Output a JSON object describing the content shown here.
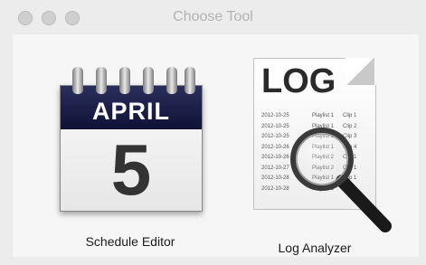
{
  "window": {
    "title": "Choose Tool"
  },
  "tools": {
    "schedule": {
      "label": "Schedule Editor",
      "icon": "calendar-icon",
      "month": "APRIL",
      "day": "5"
    },
    "log": {
      "label": "Log Analyzer",
      "icon": "log-document-icon",
      "doc_title": "LOG",
      "rows": [
        {
          "date": "2012-10-25",
          "playlist": "Playlist 1",
          "clip": "Clip 1"
        },
        {
          "date": "2012-10-25",
          "playlist": "Playlist 1",
          "clip": "Clip 2"
        },
        {
          "date": "2012-10-25",
          "playlist": "Playlist 1",
          "clip": "Clip 3"
        },
        {
          "date": "2012-10-26",
          "playlist": "Playlist 1",
          "clip": "Clip 4"
        },
        {
          "date": "2012-10-26",
          "playlist": "Playlist 2",
          "clip": "Clip 1"
        },
        {
          "date": "2012-10-27",
          "playlist": "Playlist 2",
          "clip": "Clip 1"
        },
        {
          "date": "2012-10-28",
          "playlist": "Playlist 1",
          "clip": "Clip 1"
        },
        {
          "date": "2012-10-28",
          "playlist": "Playlist 1",
          "clip": "Clip 1"
        }
      ]
    }
  }
}
